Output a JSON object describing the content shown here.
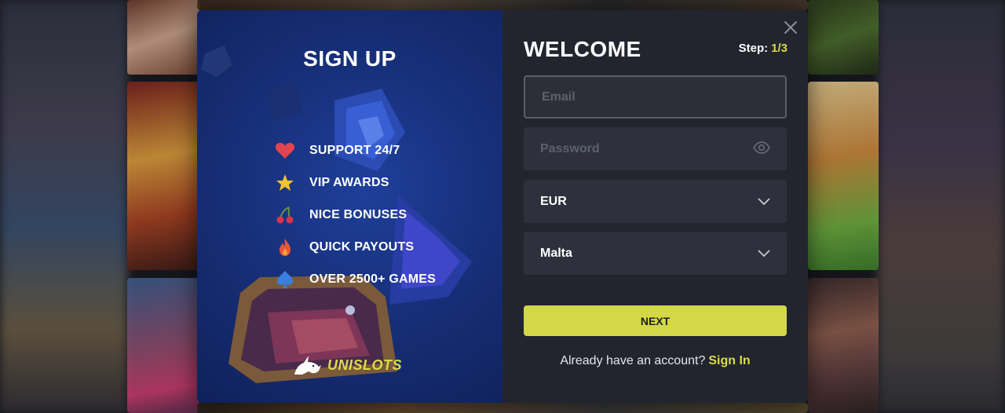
{
  "promo": {
    "title": "SIGN UP",
    "features": [
      {
        "label": "SUPPORT 24/7",
        "icon": "heart-icon"
      },
      {
        "label": "VIP AWARDS",
        "icon": "star-icon"
      },
      {
        "label": "NICE BONUSES",
        "icon": "cherries-icon"
      },
      {
        "label": "QUICK PAYOUTS",
        "icon": "fire-icon"
      },
      {
        "label": "OVER 2500+ GAMES",
        "icon": "spade-icon"
      }
    ],
    "logo_text": "UNISLOTS"
  },
  "form": {
    "title": "WELCOME",
    "step_label": "Step:",
    "step_value": "1/3",
    "email_placeholder": "Email",
    "password_placeholder": "Password",
    "currency_value": "EUR",
    "country_value": "Malta",
    "next_label": "NEXT",
    "signin_prompt": "Already have an account?",
    "signin_link": "Sign In"
  },
  "colors": {
    "accent": "#d3d846",
    "form_bg": "#22252e",
    "promo_bg": "#17307a",
    "field_bg": "#2e313b"
  }
}
